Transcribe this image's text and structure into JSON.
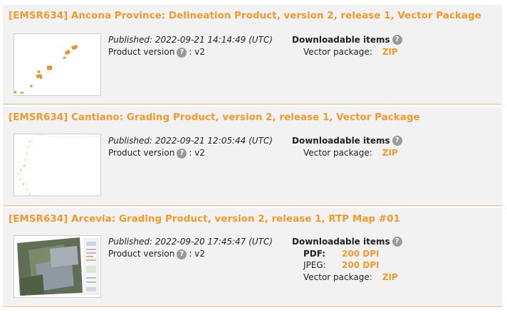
{
  "products": [
    {
      "title": "[EMSR634] Ancona Province: Delineation Product, version 2, release 1, Vector Package",
      "published": "Published: 2022-09-21 14:14:49 (UTC)",
      "version_label": "Product version",
      "version_value": ": v2",
      "downloads_heading": "Downloadable items",
      "vector_label": "Vector package:",
      "vector_link": "ZIP"
    },
    {
      "title": "[EMSR634] Cantiano: Grading Product, version 2, release 1, Vector Package",
      "published": "Published: 2022-09-21 12:05:44 (UTC)",
      "version_label": "Product version",
      "version_value": ": v2",
      "downloads_heading": "Downloadable items",
      "vector_label": "Vector package:",
      "vector_link": "ZIP"
    },
    {
      "title": "[EMSR634] Arcevia: Grading Product, version 2, release 1, RTP Map #01",
      "published": "Published: 2022-09-20 17:45:47 (UTC)",
      "version_label": "Product version",
      "version_value": ": v2",
      "downloads_heading": "Downloadable items",
      "pdf_label": "PDF:",
      "pdf_link": "200 DPI",
      "jpeg_label": "JPEG:",
      "jpeg_link": "200 DPI",
      "vector_label": "Vector package:",
      "vector_link": "ZIP"
    }
  ],
  "help_glyph": "?",
  "colors": {
    "accent": "#f29a2e",
    "panel": "#f2f2f2",
    "help": "#9a9a9a",
    "divider": "#f0b87a"
  }
}
